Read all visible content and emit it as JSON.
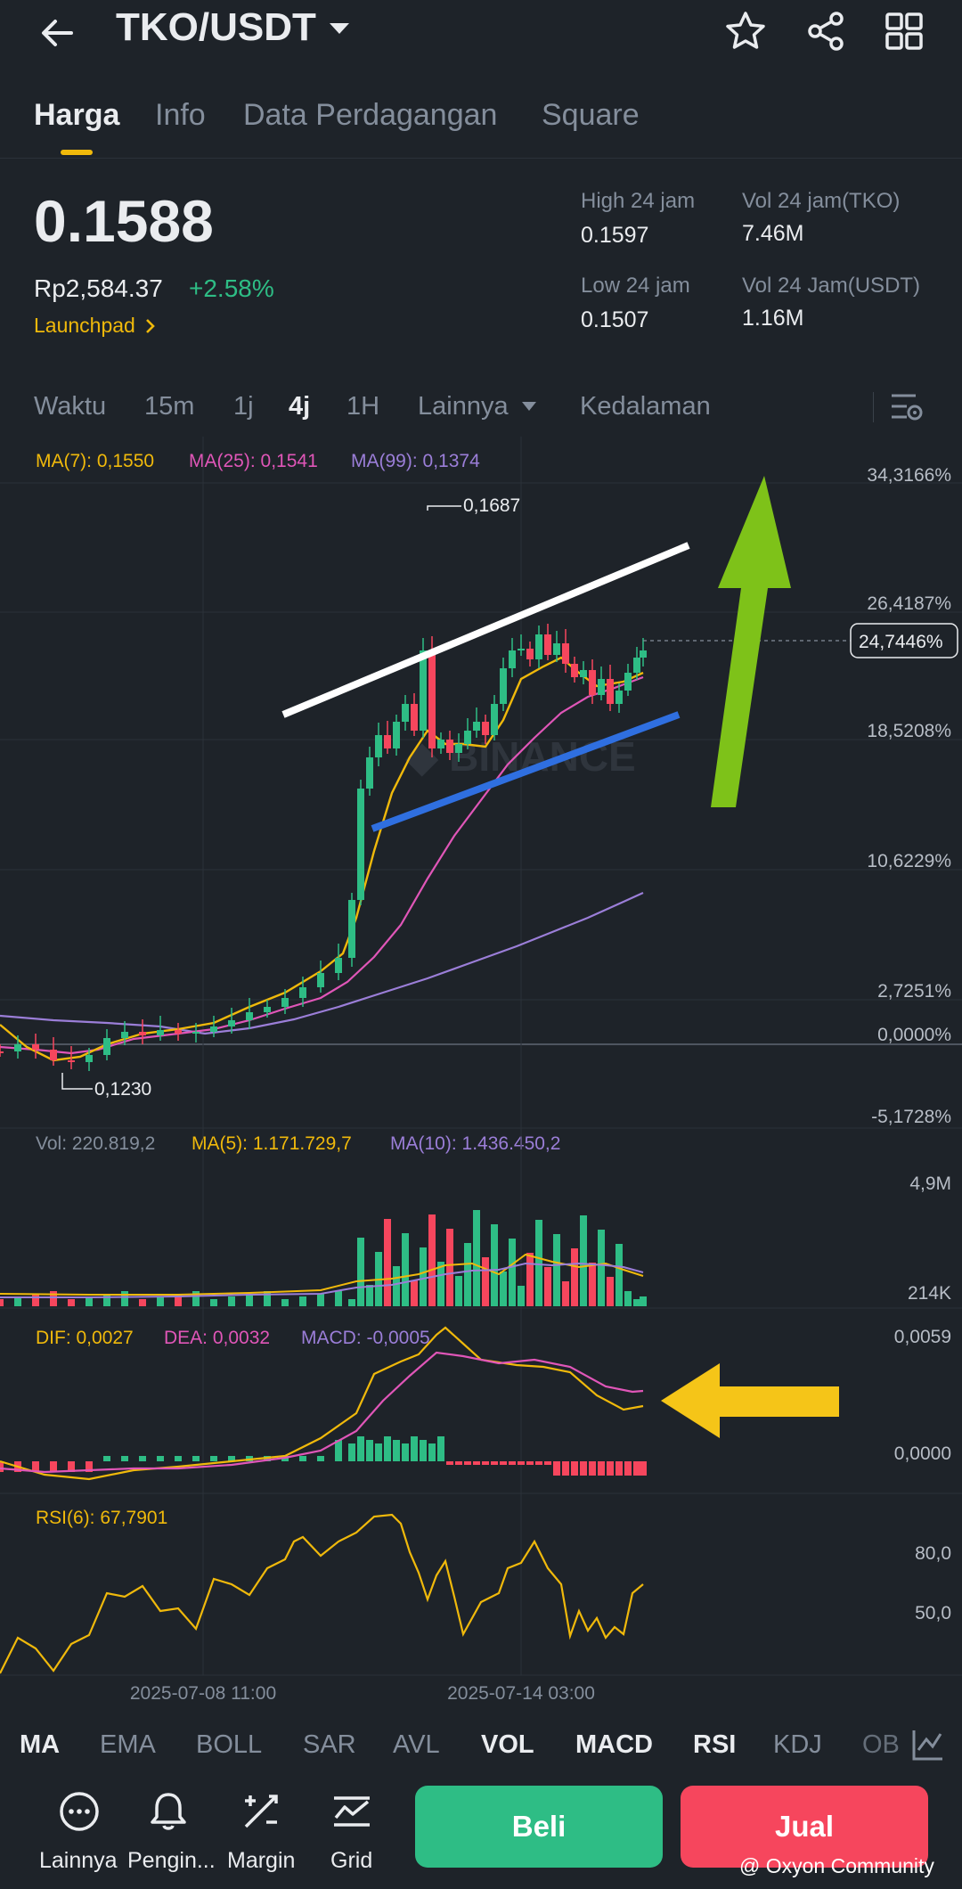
{
  "header": {
    "pair": "TKO/USDT",
    "icons": [
      "back-arrow-icon",
      "star-icon",
      "share-icon",
      "grid-icon"
    ]
  },
  "tabs": [
    "Harga",
    "Info",
    "Data Perdagangan",
    "Square"
  ],
  "price": {
    "last": "0.1588",
    "fiat": "Rp2,584.37",
    "change": "+2.58%",
    "launchpad": "Launchpad",
    "high_label": "High 24 jam",
    "high": "0.1597",
    "low_label": "Low 24 jam",
    "low": "0.1507",
    "vol_tko_label": "Vol 24 jam(TKO)",
    "vol_tko": "7.46M",
    "vol_usdt_label": "Vol 24 Jam(USDT)",
    "vol_usdt": "1.16M"
  },
  "timeframes": [
    "Waktu",
    "15m",
    "1j",
    "4j",
    "1H",
    "Lainnya",
    "Kedalaman"
  ],
  "indicators": {
    "ma7": "MA(7): 0,1550",
    "ma25": "MA(25): 0,1541",
    "ma99": "MA(99): 0,1374",
    "vol": "Vol: 220.819,2",
    "vol_ma5": "MA(5): 1.171.729,7",
    "vol_ma10": "MA(10): 1.436.450,2",
    "dif": "DIF: 0,0027",
    "dea": "DEA: 0,0032",
    "macd": "MACD: -0,0005",
    "rsi": "RSI(6): 67,7901"
  },
  "chart_labels": {
    "y_axis": [
      "34,3166%",
      "26,4187%",
      "18,5208%",
      "10,6229%",
      "2,7251%",
      "0,0000%",
      "-5,1728%"
    ],
    "current": "24,7446%",
    "high_mark": "0,1687",
    "low_mark": "0,1230",
    "vol_axis": [
      "4,9M",
      "214K"
    ],
    "macd_axis": [
      "0,0059",
      "0,0000"
    ],
    "rsi_axis": [
      "80,0",
      "50,0"
    ],
    "dates": [
      "2025-07-08 11:00",
      "2025-07-14 03:00"
    ]
  },
  "indicator_bar": [
    {
      "label": "MA",
      "on": true
    },
    {
      "label": "EMA",
      "on": false
    },
    {
      "label": "BOLL",
      "on": false
    },
    {
      "label": "SAR",
      "on": false
    },
    {
      "label": "AVL",
      "on": false
    },
    {
      "label": "VOL",
      "on": true
    },
    {
      "label": "MACD",
      "on": true
    },
    {
      "label": "RSI",
      "on": true
    },
    {
      "label": "KDJ",
      "on": false
    },
    {
      "label": "OB",
      "on": false
    }
  ],
  "bottom": {
    "more": "Lainnya",
    "alert": "Pengin...",
    "margin": "Margin",
    "grid": "Grid",
    "buy": "Beli",
    "sell": "Jual"
  },
  "watermark": "@ Oxyon Community",
  "colors": {
    "up": "#2ebd85",
    "down": "#f6465d",
    "ma7": "#f0b90b",
    "ma25": "#e056b8",
    "ma99": "#9b7ed8",
    "accent": "#f0b90b"
  }
}
